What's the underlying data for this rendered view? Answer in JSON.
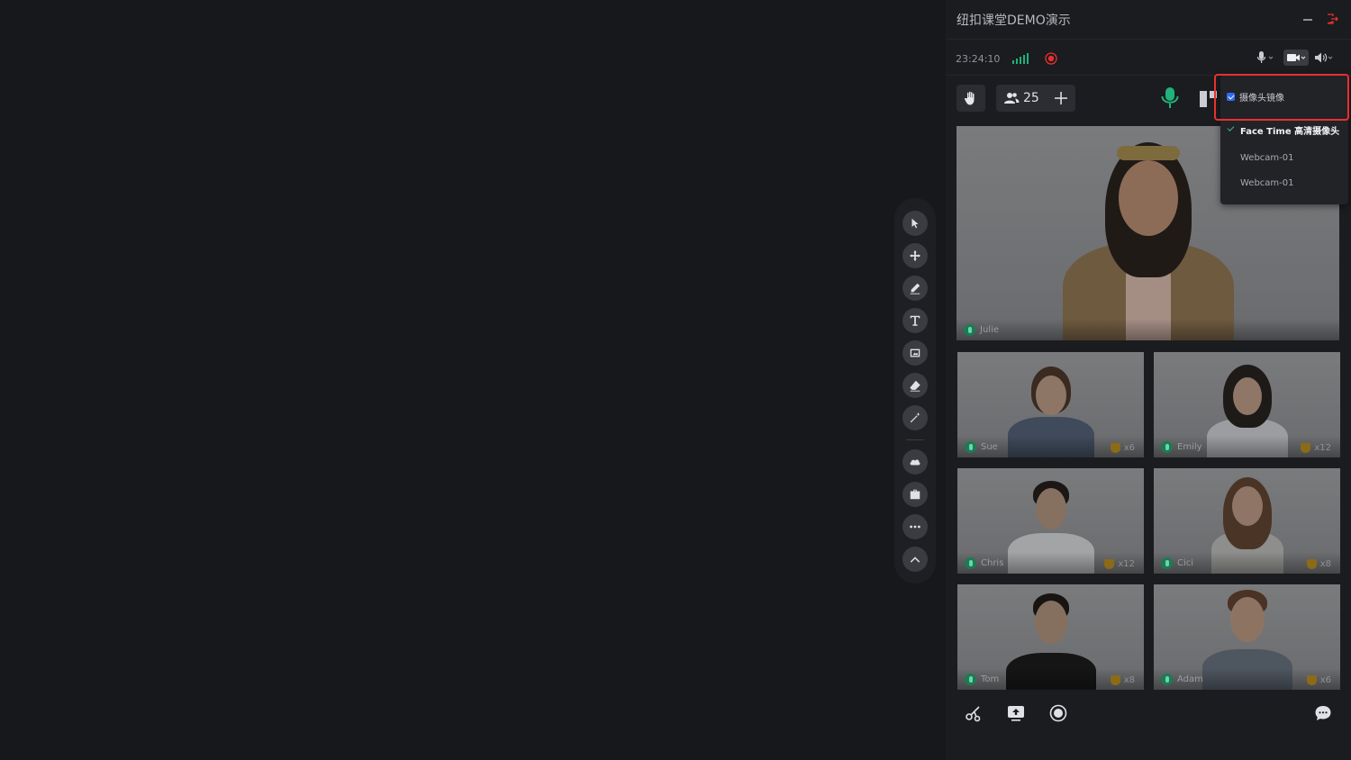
{
  "header": {
    "title": "纽扣课堂DEMO演示"
  },
  "status": {
    "clock": "23:24:10"
  },
  "controls": {
    "participant_count": "25"
  },
  "camera_menu": {
    "mirror_label": "摄像头镜像",
    "mirror_checked": true,
    "options": [
      {
        "label": "Face Time 高清摄像头",
        "selected": true
      },
      {
        "label": "Webcam-01",
        "selected": false
      },
      {
        "label": "Webcam-01",
        "selected": false
      }
    ]
  },
  "teacher": {
    "name": "Julie"
  },
  "students": [
    {
      "name": "Sue",
      "trophies": "x6"
    },
    {
      "name": "Emily",
      "trophies": "x12"
    },
    {
      "name": "Chris",
      "trophies": "x12"
    },
    {
      "name": "Cici",
      "trophies": "x8"
    },
    {
      "name": "Tom",
      "trophies": "x8"
    },
    {
      "name": "Adam",
      "trophies": "x6"
    }
  ],
  "colors": {
    "accent_green": "#1fb27a",
    "record_red": "#e8312e",
    "checkbox_blue": "#2f6bf0",
    "trophy_gold": "#8b6a18"
  },
  "toolbar_icons": [
    "select-icon",
    "move-icon",
    "pen-icon",
    "text-icon",
    "image-icon",
    "eraser-icon",
    "magic-wand-icon",
    "cloud-icon",
    "toolbox-icon",
    "more-icon",
    "collapse-icon"
  ]
}
